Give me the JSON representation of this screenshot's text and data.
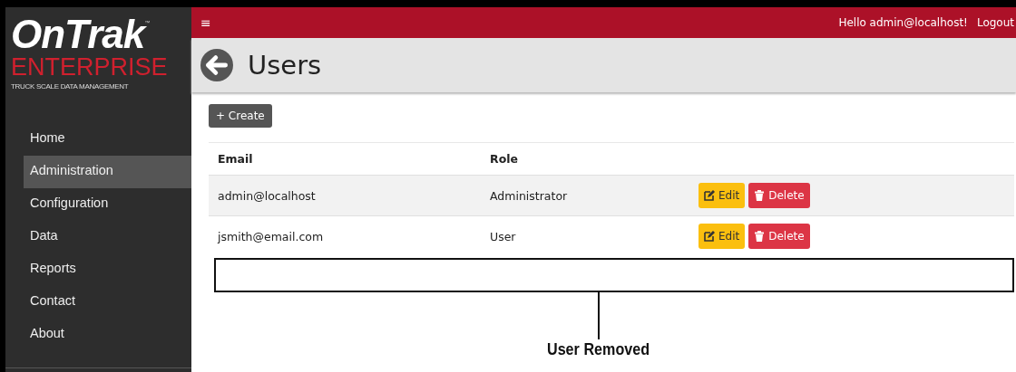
{
  "logo": {
    "wordmark": "OnTrak",
    "trademark": "™",
    "subtitle": "ENTERPRISE",
    "tagline": "TRUCK SCALE DATA MANAGEMENT"
  },
  "sidebar": {
    "items": [
      {
        "label": "Home",
        "selected": false
      },
      {
        "label": "Administration",
        "selected": true
      },
      {
        "label": "Configuration",
        "selected": false
      },
      {
        "label": "Data",
        "selected": false
      },
      {
        "label": "Reports",
        "selected": false
      },
      {
        "label": "Contact",
        "selected": false
      },
      {
        "label": "About",
        "selected": false
      }
    ]
  },
  "topbar": {
    "menu_glyph": "≡",
    "greeting": "Hello admin@localhost!",
    "logout": "Logout"
  },
  "page": {
    "title": "Users",
    "create_button": "+ Create"
  },
  "table": {
    "columns": [
      "Email",
      "Role"
    ],
    "rows": [
      {
        "email": "admin@localhost",
        "role": "Administrator",
        "edit": "Edit",
        "delete": "Delete"
      },
      {
        "email": "jsmith@email.com",
        "role": "User",
        "edit": "Edit",
        "delete": "Delete"
      }
    ]
  },
  "annotation": {
    "label": "User Removed"
  }
}
